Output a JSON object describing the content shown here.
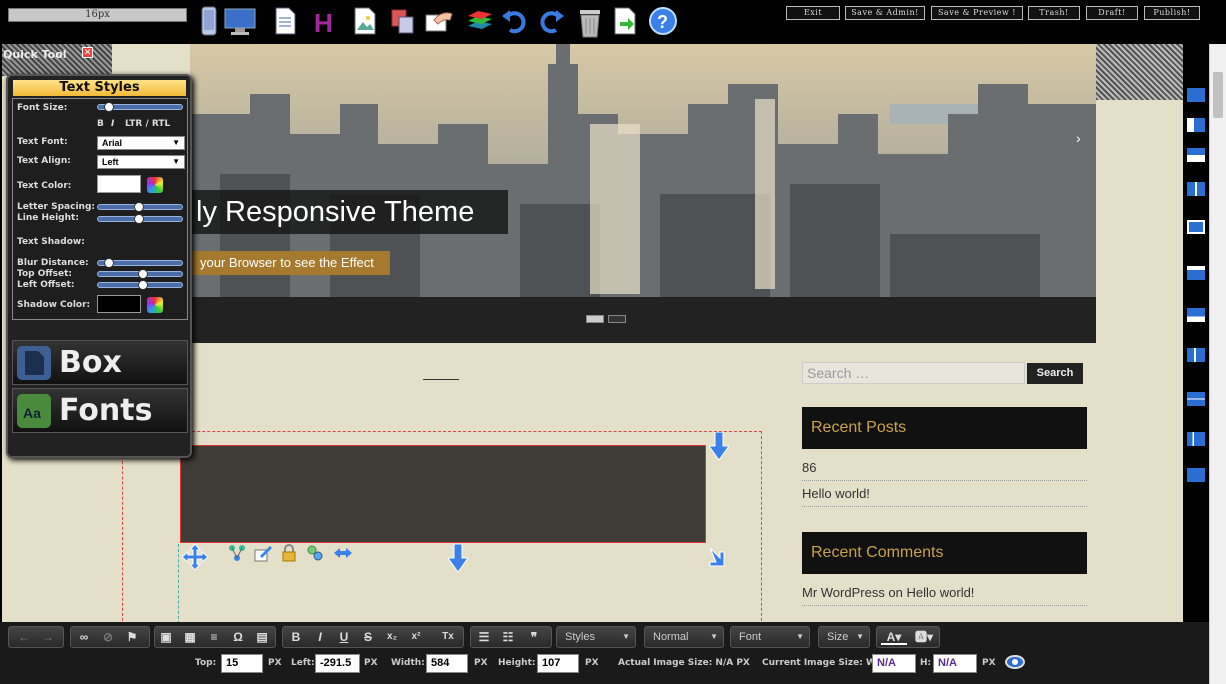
{
  "topbar": {
    "size_readout": "16px",
    "buttons": [
      "Exit",
      "Save & Admin!",
      "Save & Preview !",
      "Trash!",
      "Draft!",
      "Publish!"
    ],
    "icons": [
      "mobile-icon",
      "desktop-icon",
      "document-icon",
      "heading-icon",
      "image-icon",
      "copy-icon",
      "hand-icon",
      "layers-icon",
      "undo-icon",
      "redo-icon",
      "trash-icon",
      "export-icon",
      "help-icon"
    ]
  },
  "quicktool": {
    "label": "Quick Tool",
    "close": "✕"
  },
  "text_styles": {
    "title": "Text Styles",
    "font_size_label": "Font Size:",
    "format_buttons": {
      "bold": "B",
      "italic": "I",
      "direction": "LTR / RTL"
    },
    "text_font_label": "Text Font:",
    "text_font_value": "Arial",
    "text_align_label": "Text Align:",
    "text_align_value": "Left",
    "text_color_label": "Text Color:",
    "letter_spacing_label": "Letter Spacing:",
    "line_height_label": "Line Height:",
    "text_shadow_label": "Text Shadow:",
    "blur_label": "Blur Distance:",
    "top_offset_label": "Top Offset:",
    "left_offset_label": "Left Offset:",
    "shadow_color_label": "Shadow Color:",
    "text_color": "#ffffff",
    "shadow_color": "#000000"
  },
  "panel_buttons": {
    "box": "Box",
    "fonts": "Fonts"
  },
  "hero": {
    "title": "ly Responsive Theme",
    "subtitle": "your Browser to see the Effect"
  },
  "sidebar": {
    "search_placeholder": "Search …",
    "search_button": "Search",
    "recent_posts_title": "Recent Posts",
    "recent_posts": [
      "86",
      "Hello world!"
    ],
    "recent_comments_title": "Recent Comments",
    "recent_comments": [
      "Mr WordPress on Hello world!"
    ]
  },
  "editor_toolbar": {
    "styles": "Styles",
    "format": "Normal",
    "font": "Font",
    "size": "Size",
    "buttons": {
      "bold": "B",
      "italic": "I",
      "underline": "U",
      "strike": "S",
      "sub": "x₂",
      "sup": "x²",
      "clear": "Tx",
      "quote": "❞",
      "omega": "Ω"
    }
  },
  "position": {
    "top_label": "Top:",
    "top_value": "15",
    "top_unit": "PX",
    "left_label": "Left:",
    "left_value": "-291.5",
    "left_unit": "PX",
    "width_label": "Width:",
    "width_value": "584",
    "width_unit": "PX",
    "height_label": "Height:",
    "height_value": "107",
    "height_unit": "PX",
    "actual_size_label": "Actual Image Size: N/A PX",
    "current_size_label": "Current Image Size: W:",
    "current_w": "N/A",
    "h_label": "H:",
    "current_h": "N/A",
    "h_unit": "PX"
  },
  "colors": {
    "accent": "#c9a24a",
    "canvas": "#e3dfc8",
    "selection": "#dd4444"
  }
}
